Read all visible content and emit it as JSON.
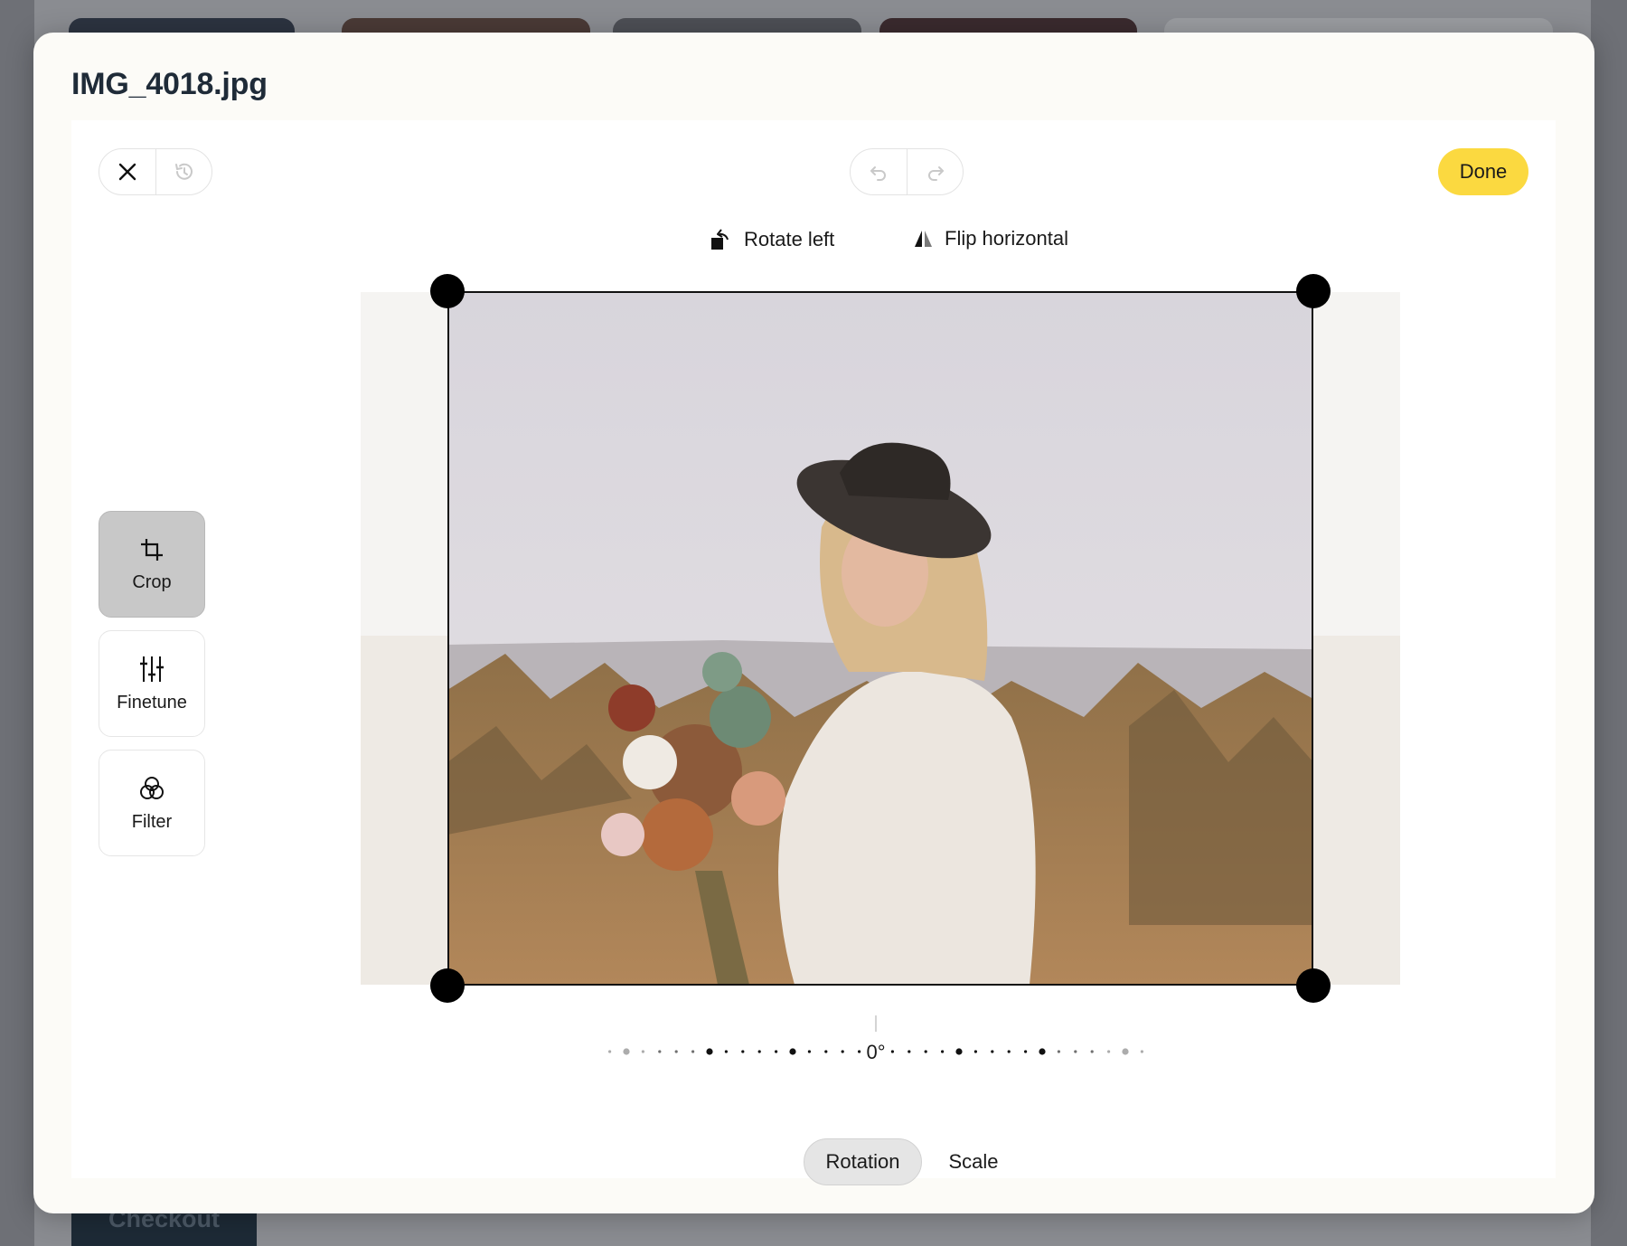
{
  "modal": {
    "title": "IMG_4018.jpg"
  },
  "toolbar": {
    "close_icon": "close-icon",
    "revert_icon": "history-icon",
    "undo_icon": "undo-icon",
    "redo_icon": "redo-icon",
    "done_label": "Done",
    "done_color": "#fbd940"
  },
  "actions": {
    "rotate_left_label": "Rotate left",
    "flip_horizontal_label": "Flip horizontal"
  },
  "tools": [
    {
      "label": "Crop",
      "icon": "crop-icon",
      "active": true
    },
    {
      "label": "Finetune",
      "icon": "sliders-icon",
      "active": false
    },
    {
      "label": "Filter",
      "icon": "filter-icon",
      "active": false
    }
  ],
  "rotation": {
    "value_label": "0°"
  },
  "tabs": [
    {
      "label": "Rotation",
      "active": true
    },
    {
      "label": "Scale",
      "active": false
    }
  ],
  "background": {
    "checkout_label": "Checkout"
  }
}
